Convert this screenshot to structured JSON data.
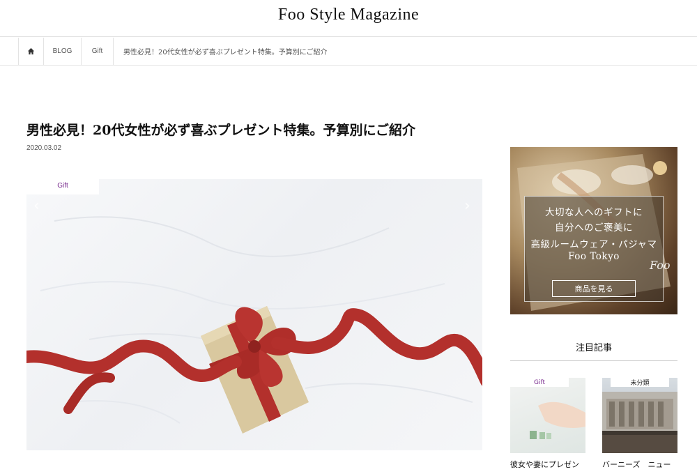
{
  "site": {
    "title": "Foo Style Magazine"
  },
  "breadcrumb": {
    "home_icon": "home-icon",
    "items": [
      "BLOG",
      "Gift"
    ],
    "current": "男性必見！20代女性が必ず喜ぶプレゼント特集。予算別にご紹介"
  },
  "article": {
    "title": "男性必見！20代女性が必ず喜ぶプレゼント特集。予算別にご紹介",
    "date": "2020.03.02",
    "category": "Gift",
    "prev_icon": "chevron-left-icon",
    "next_icon": "chevron-right-icon"
  },
  "banner": {
    "line1": "大切な人へのギフトに",
    "line2": "自分へのご褒美に",
    "line3": "高級ルームウェア・パジャマ",
    "line4": "Foo Tokyo",
    "button": "商品を見る",
    "logo": "Foo"
  },
  "featured": {
    "heading": "注目記事",
    "items": [
      {
        "category": "Gift",
        "title": "彼女や妻にプレゼン"
      },
      {
        "category": "未分類",
        "title": "バーニーズ　ニュー"
      }
    ]
  },
  "colors": {
    "accent": "#7a2d8f",
    "ribbon": "#b3302c",
    "box": "#d6c49a"
  }
}
